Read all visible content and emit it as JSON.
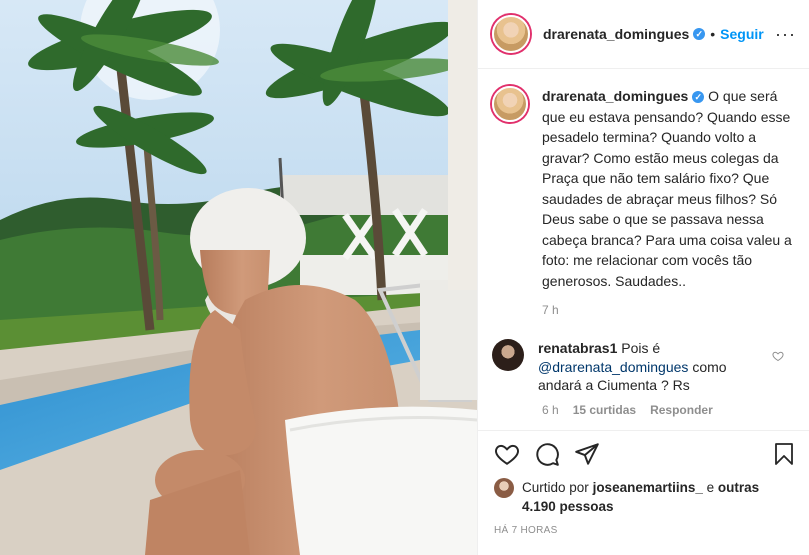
{
  "post": {
    "username": "drarenata_domingues",
    "verified_badge": "✓",
    "separator": "•",
    "follow_label": "Seguir",
    "more_label": "···"
  },
  "caption": {
    "username": "drarenata_domingues",
    "text": "O que será que eu estava pensando? Quando esse pesadelo termina? Quando volto a gravar? Como estão meus colegas da Praça que não tem salário fixo? Que saudades de abraçar meus filhos? Só Deus sabe o que se passava nessa cabeça branca? Para uma coisa valeu a foto: me relacionar com vocês tão generosos. Saudades..",
    "time": "7 h"
  },
  "comment": {
    "username": "renatabras1",
    "text": "Pois é",
    "mention": "@drarenata_domingues",
    "text_after": "como andará a Ciumenta ? Rs",
    "time": "6 h",
    "likes": "15 curtidas",
    "reply": "Responder"
  },
  "likes": {
    "prefix": "Curtido por",
    "user": "joseanemartiins_",
    "connector": "e",
    "others": "outras 4.190 pessoas"
  },
  "timestamp": "HÁ 7 HORAS",
  "icons": {
    "like": "heart-icon",
    "comment": "comment-icon",
    "share": "share-icon",
    "save": "bookmark-icon",
    "more": "more-icon",
    "verified": "verified-icon"
  },
  "colors": {
    "accent": "#0095f6",
    "verified": "#3897f0",
    "muted": "#8e8e8e",
    "text": "#262626",
    "story_ring": "#e1306c"
  }
}
